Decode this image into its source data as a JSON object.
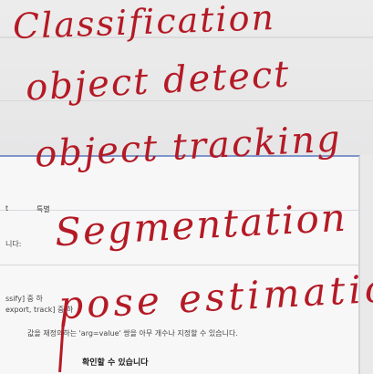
{
  "handwriting": {
    "line1": "Classification",
    "line2": "object detect",
    "line3": "object tracking",
    "line4": "Segmentation",
    "line5": "pose estimation"
  },
  "document": {
    "tab_special": "특별",
    "line_a": "니다:",
    "line_b": "ssify] 중 하",
    "line_c": "export, track] 중 하",
    "line_d": "값을 재정의하는 'arg=value' 쌍을 아무 개수나 지정할 수 있습니다.",
    "line_e": "확인할 수 있습니다"
  },
  "colors": {
    "ink": "#b41a25",
    "doc_border": "#7f95c9"
  }
}
